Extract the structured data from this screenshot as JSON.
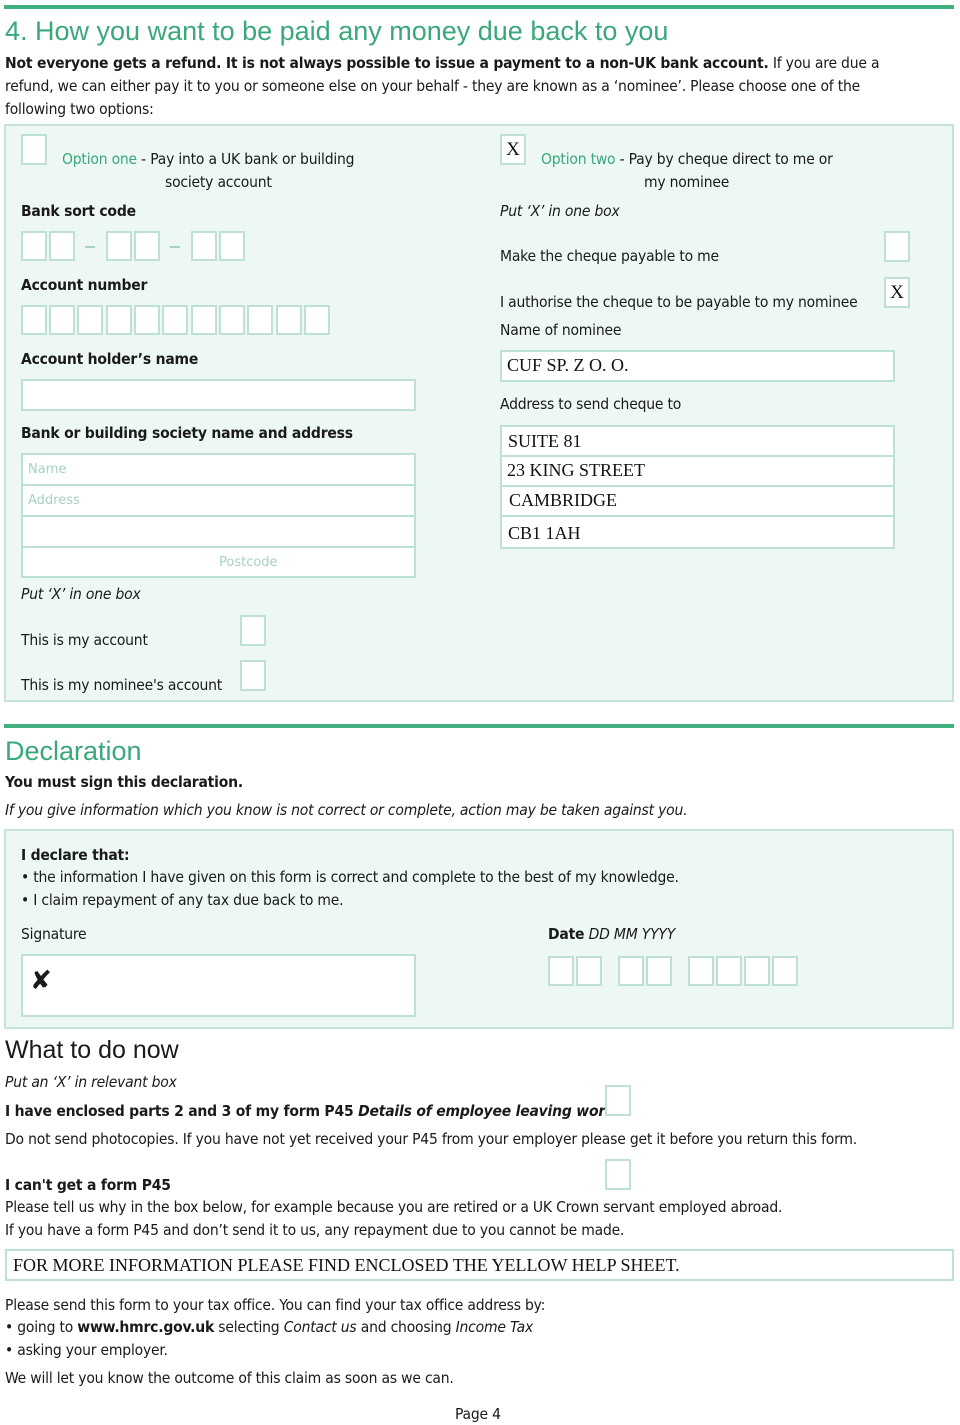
{
  "section4": {
    "title": "4. How you want to be paid any money due back to you",
    "intro_bold": "Not everyone gets a refund. It is not always possible to issue a payment to a non-UK bank account.",
    "intro_rest_line1": " If you are due a",
    "intro_line2": "refund, we can either pay it to you or someone else on your behalf - they are known as a ‘nominee’. Please choose one of the",
    "intro_line3": "following two options:",
    "option_one": {
      "checked": "",
      "label": "Option one",
      "desc_line1": " - Pay into a UK bank or building",
      "desc_line2": "society account",
      "sort_code_label": "Bank sort code",
      "account_number_label": "Account number",
      "holder_name_label": "Account holder’s name",
      "bank_name_address_label": "Bank or building society name and address",
      "name_placeholder": "Name",
      "address_placeholder": "Address",
      "postcode_placeholder": "Postcode",
      "put_x": "Put ‘X’ in one box",
      "my_account_label": "This is my account",
      "my_account_checked": "",
      "nominee_account_label": "This is my nominee's account",
      "nominee_account_checked": ""
    },
    "option_two": {
      "checked": "X",
      "label": "Option two",
      "desc_line1": " - Pay by cheque direct to me or",
      "desc_line2": "my nominee",
      "put_x": "Put ‘X’ in one box",
      "payable_to_me_label": "Make the cheque payable to me",
      "payable_to_me_checked": "",
      "payable_to_nominee_label": "I authorise the cheque to be payable to my nominee",
      "payable_to_nominee_checked": "X",
      "nominee_name_label": "Name of nominee",
      "nominee_name_value": "CUF SP. Z O. O.",
      "address_label": "Address to send cheque to",
      "address_lines": [
        "SUITE 81",
        "23 KING STREET",
        "CAMBRIDGE",
        "CB1 1AH"
      ]
    }
  },
  "declaration": {
    "title": "Declaration",
    "must_sign": "You must sign this declaration.",
    "warning": "If you give information which you know is not correct or complete, action may be taken against you.",
    "declare_heading": "I declare that:",
    "bullets": [
      "the information I have given on this form is correct and complete to the best of my knowledge.",
      "I claim repayment of any tax due back to me."
    ],
    "signature_label": "Signature",
    "signature_mark": "✘",
    "date_label": "Date",
    "date_format": "DD MM YYYY"
  },
  "what_next": {
    "title": "What to do now",
    "put_x": "Put an ‘X’ in relevant box",
    "p45_enclosed_bold": "I have enclosed parts 2 and 3 of my form P45 ",
    "p45_enclosed_italic": "Details of employee leaving work",
    "p45_enclosed_checked": "",
    "no_photocopies": "Do not send photocopies. If you have not yet received your P45 from your employer please get it before you return this form.",
    "cant_get_p45": "I can't get a form P45",
    "cant_get_checked": "",
    "tell_us_why": "Please tell us why in the box below, for example because you are retired or a UK Crown servant employed abroad.",
    "warning": "If you have a form P45 and don’t send it to us, any repayment due to you cannot be made.",
    "reason_value": "FOR MORE INFORMATION PLEASE FIND ENCLOSED THE YELLOW HELP SHEET.",
    "send_form": "Please send this form to your tax office. You can find your tax office address by:",
    "bullet1_a": "going to ",
    "bullet1_link": "www.hmrc.gov.uk",
    "bullet1_b": " selecting ",
    "bullet1_c": "Contact us",
    "bullet1_d": " and choosing ",
    "bullet1_e": "Income Tax",
    "bullet2": "asking your employer.",
    "outcome": "We will let you know the outcome of this claim as soon as we can."
  },
  "footer": {
    "page": "Page 4"
  }
}
